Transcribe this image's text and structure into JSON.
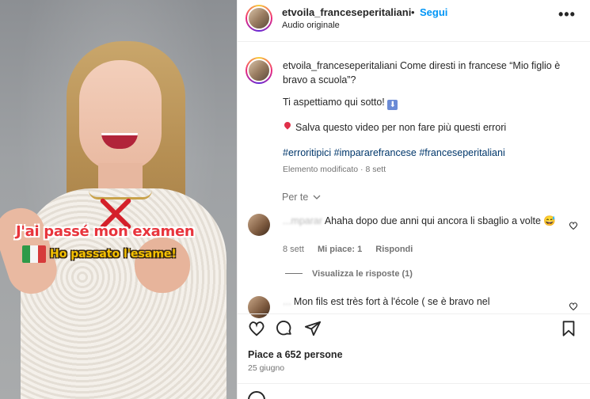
{
  "video": {
    "overlay_wrong": "J'ai passé mon examen",
    "overlay_right": "Ho passato l'esame!"
  },
  "header": {
    "username": "etvoila_franceseperitaliani",
    "separator": "•",
    "follow_label": "Segui",
    "subtitle": "Audio originale",
    "more_label": "•••"
  },
  "caption": {
    "username": "etvoila_franceseperitaliani",
    "text": "Come diresti in francese “Mio figlio è bravo a scuola”?",
    "line2": "Ti aspettiamo qui sotto!",
    "line2_emoji": "⬇",
    "line3": "Salva questo video per non fare più questi errori",
    "hashtags": [
      "#erroritipici",
      "#impararefrancese",
      "#franceseperitaliani"
    ],
    "edited": "Elemento modificato · 8 sett"
  },
  "per_te": "Per te",
  "comments": [
    {
      "username_partial": "...mparar",
      "text": "Ahaha dopo due anni qui ancora li sbaglio a volte 😅",
      "time": "8 sett",
      "likes": "Mi piace: 1",
      "reply": "Rispondi",
      "view_replies": "Visualizza le risposte (1)"
    },
    {
      "username_partial": "...",
      "text": "Mon fils est très fort à l'école ( se è bravo nel"
    }
  ],
  "footer": {
    "likes": "Piace a 652 persone",
    "date": "25 giugno"
  }
}
